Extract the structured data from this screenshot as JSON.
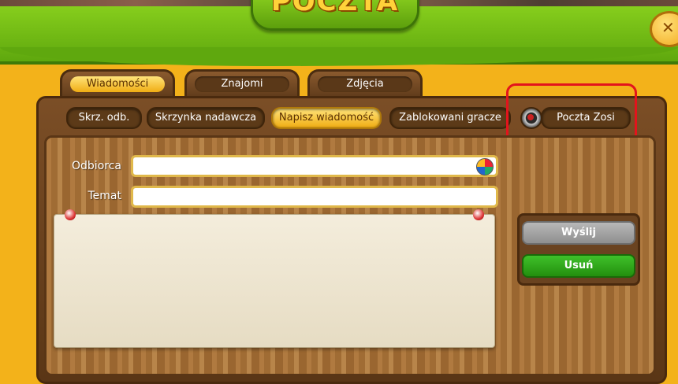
{
  "app": {
    "title": "POCZTA",
    "close_label": "✕"
  },
  "tabs": [
    {
      "label": "Wiadomości",
      "active": true
    },
    {
      "label": "Znajomi",
      "active": false
    },
    {
      "label": "Zdjęcia",
      "active": false
    }
  ],
  "subnav": [
    {
      "label": "Skrz. odb.",
      "active": false
    },
    {
      "label": "Skrzynka nadawcza",
      "active": false
    },
    {
      "label": "Napisz wiadomość",
      "active": true
    },
    {
      "label": "Zablokowani gracze",
      "active": false
    },
    {
      "label": "Poczta Zosi",
      "active": false
    }
  ],
  "form": {
    "recipient_label": "Odbiorca",
    "recipient_value": "",
    "subject_label": "Temat",
    "subject_value": "",
    "message_value": ""
  },
  "actions": {
    "send_label": "Wyślij",
    "delete_label": "Usuń"
  },
  "colors": {
    "highlight": "#e3141c",
    "accent": "#f0ad14",
    "header_green": "#5fa80e"
  }
}
